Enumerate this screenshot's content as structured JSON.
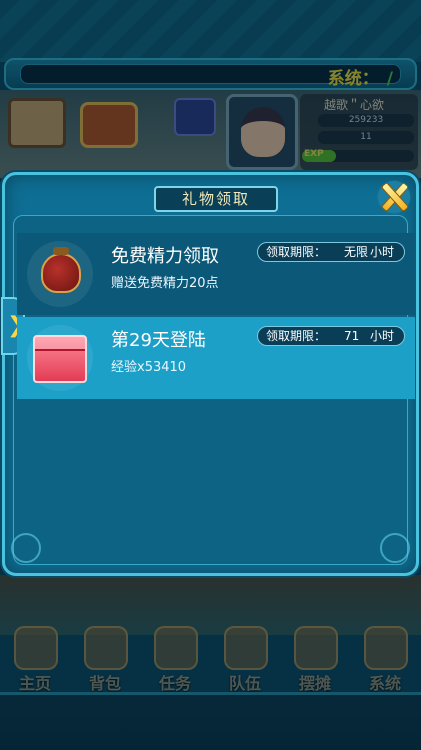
{
  "system_bar": {
    "label": "系统：",
    "slash": "/"
  },
  "player": {
    "name": "越歌＂心欲",
    "stat1": "259233",
    "stat2": "11",
    "exp_label": "EXP",
    "exp_fraction": 0.3
  },
  "dialog": {
    "title": "礼物领取",
    "gifts": [
      {
        "title": "免费精力领取",
        "desc": "赠送免费精力20点",
        "deadline_label": "领取期限：",
        "deadline_value": "无限",
        "deadline_unit": "小时",
        "icon": "red-jar-icon"
      },
      {
        "title": "第29天登陆",
        "desc": "经验x53410",
        "deadline_label": "领取期限：",
        "deadline_value": "71",
        "deadline_unit": "小时",
        "icon": "pink-gift-box-icon"
      }
    ]
  },
  "nav": {
    "items": [
      {
        "label": "主页",
        "icon": "house-icon"
      },
      {
        "label": "背包",
        "icon": "backpack-icon"
      },
      {
        "label": "任务",
        "icon": "scroll-icon"
      },
      {
        "label": "队伍",
        "icon": "team-icon"
      },
      {
        "label": "摆摊",
        "icon": "stall-icon"
      },
      {
        "label": "系统",
        "icon": "gear-icon"
      }
    ]
  },
  "colors": {
    "dialog_bg": "#0e6e93",
    "selected_row": "#1da0c8",
    "system_label": "#f6e43a"
  }
}
